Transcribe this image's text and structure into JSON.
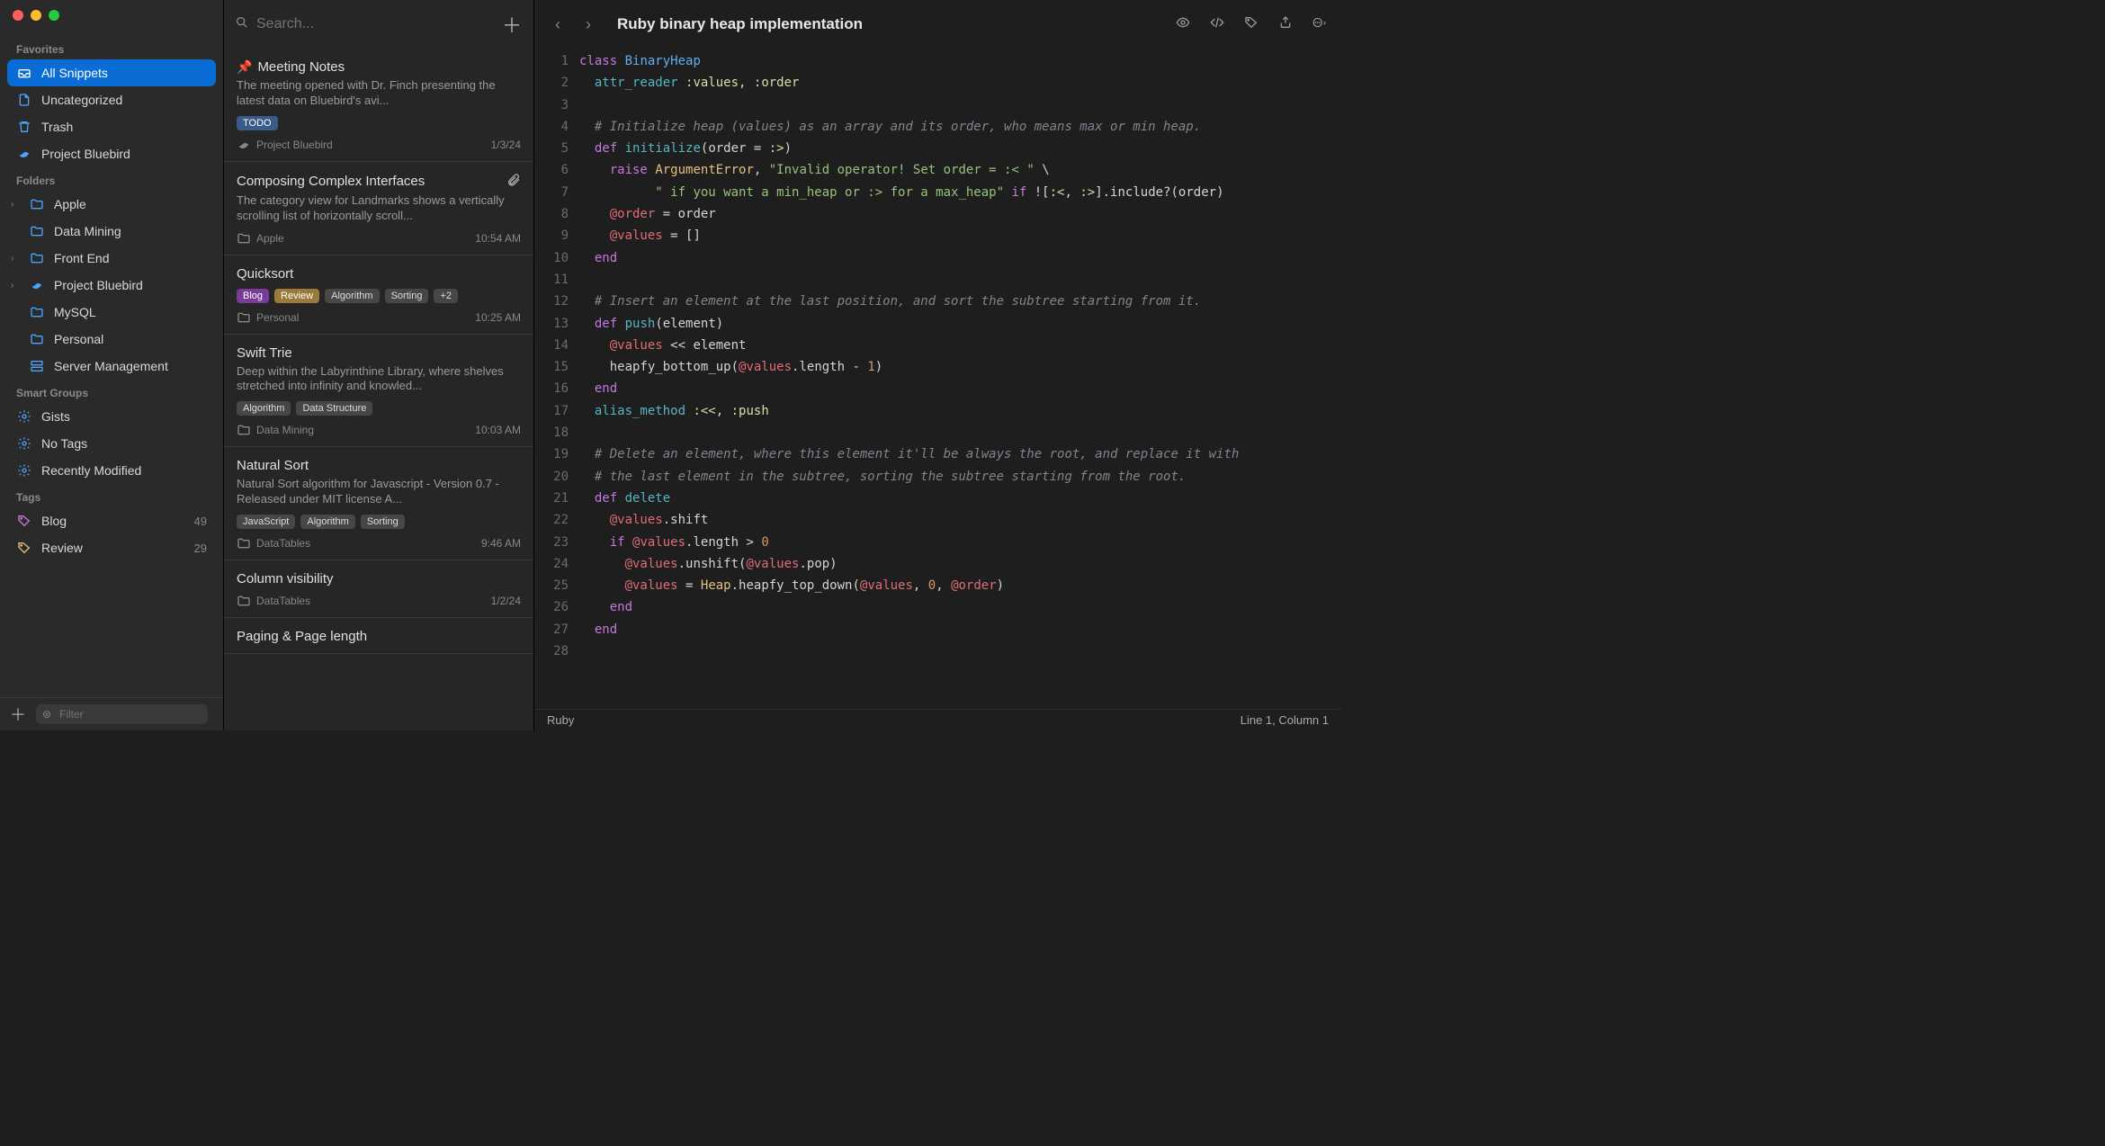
{
  "search": {
    "placeholder": "Search..."
  },
  "filter": {
    "placeholder": "Filter"
  },
  "sidebar": {
    "favorites_label": "Favorites",
    "folders_label": "Folders",
    "smart_label": "Smart Groups",
    "tags_label": "Tags",
    "favorites": [
      {
        "label": "All Snippets"
      },
      {
        "label": "Uncategorized"
      },
      {
        "label": "Trash"
      },
      {
        "label": "Project Bluebird"
      }
    ],
    "folders": [
      {
        "label": "Apple",
        "expandable": true
      },
      {
        "label": "Data Mining"
      },
      {
        "label": "Front End",
        "expandable": true
      },
      {
        "label": "Project Bluebird",
        "expandable": true
      },
      {
        "label": "MySQL"
      },
      {
        "label": "Personal"
      },
      {
        "label": "Server Management"
      }
    ],
    "smart": [
      {
        "label": "Gists"
      },
      {
        "label": "No Tags"
      },
      {
        "label": "Recently Modified"
      }
    ],
    "tags": [
      {
        "label": "Blog",
        "count": "49"
      },
      {
        "label": "Review",
        "count": "29"
      }
    ]
  },
  "snippets": [
    {
      "title": "Meeting Notes",
      "pinned": true,
      "preview": "The meeting opened with Dr. Finch presenting the latest data on Bluebird's avi...",
      "tags": [
        {
          "label": "TODO",
          "cls": "todo"
        }
      ],
      "folder": "Project Bluebird",
      "folder_icon": "bluebird",
      "time": "1/3/24"
    },
    {
      "title": "Composing Complex Interfaces",
      "attachment": true,
      "preview": "The category view for Landmarks shows a vertically scrolling list of horizontally scroll...",
      "tags": [],
      "folder": "Apple",
      "time": "10:54 AM"
    },
    {
      "title": "Quicksort",
      "preview": "",
      "tags": [
        {
          "label": "Blog",
          "cls": "blog"
        },
        {
          "label": "Review",
          "cls": "review"
        },
        {
          "label": "Algorithm",
          "cls": ""
        },
        {
          "label": "Sorting",
          "cls": ""
        },
        {
          "label": "+2",
          "cls": ""
        }
      ],
      "folder": "Personal",
      "time": "10:25 AM"
    },
    {
      "title": "Swift Trie",
      "preview": "Deep within the Labyrinthine Library, where shelves stretched into infinity and knowled...",
      "tags": [
        {
          "label": "Algorithm",
          "cls": ""
        },
        {
          "label": "Data Structure",
          "cls": ""
        }
      ],
      "folder": "Data Mining",
      "time": "10:03 AM"
    },
    {
      "title": "Natural Sort",
      "preview": "Natural Sort algorithm for Javascript - Version 0.7 - Released under MIT license A...",
      "tags": [
        {
          "label": "JavaScript",
          "cls": ""
        },
        {
          "label": "Algorithm",
          "cls": ""
        },
        {
          "label": "Sorting",
          "cls": ""
        }
      ],
      "folder": "DataTables",
      "time": "9:46 AM"
    },
    {
      "title": "Column visibility",
      "preview": "",
      "tags": [],
      "folder": "DataTables",
      "time": "1/2/24"
    },
    {
      "title": "Paging & Page length",
      "preview": "",
      "tags": [],
      "folder": "",
      "time": ""
    }
  ],
  "editor": {
    "title": "Ruby binary heap implementation",
    "language": "Ruby",
    "cursor": "Line 1, Column 1",
    "code": [
      {
        "n": 1,
        "html": "<span class='kw'>class</span> <span class='cls'>BinaryHeap</span>"
      },
      {
        "n": 2,
        "html": "  <span class='fn'>attr_reader</span> <span class='sym'>:values</span>, <span class='sym'>:order</span>"
      },
      {
        "n": 3,
        "html": ""
      },
      {
        "n": 4,
        "html": "  <span class='com'># Initialize heap (values) as an array and its order, who means max or min heap.</span>"
      },
      {
        "n": 5,
        "html": "  <span class='kw'>def</span> <span class='fn'>initialize</span>(order = <span class='sym'>:&gt;</span>)"
      },
      {
        "n": 6,
        "html": "    <span class='kw'>raise</span> <span class='const'>ArgumentError</span>, <span class='str'>\"Invalid operator! Set order = :&lt; \"</span> \\"
      },
      {
        "n": 7,
        "html": "          <span class='str'>\" if you want a min_heap or :&gt; for a max_heap\"</span> <span class='kw'>if</span> ![<span class='sym'>:&lt;</span>, <span class='sym'>:&gt;</span>].include?(order)"
      },
      {
        "n": 8,
        "html": "    <span class='ivar'>@order</span> = order"
      },
      {
        "n": 9,
        "html": "    <span class='ivar'>@values</span> = []"
      },
      {
        "n": 10,
        "html": "  <span class='kw'>end</span>"
      },
      {
        "n": 11,
        "html": ""
      },
      {
        "n": 12,
        "html": "  <span class='com'># Insert an element at the last position, and sort the subtree starting from it.</span>"
      },
      {
        "n": 13,
        "html": "  <span class='kw'>def</span> <span class='fn'>push</span>(element)"
      },
      {
        "n": 14,
        "html": "    <span class='ivar'>@values</span> &lt;&lt; element"
      },
      {
        "n": 15,
        "html": "    heapfy_bottom_up(<span class='ivar'>@values</span>.length - <span class='num'>1</span>)"
      },
      {
        "n": 16,
        "html": "  <span class='kw'>end</span>"
      },
      {
        "n": 17,
        "html": "  <span class='fn'>alias_method</span> <span class='sym'>:&lt;&lt;</span>, <span class='sym'>:push</span>"
      },
      {
        "n": 18,
        "html": ""
      },
      {
        "n": 19,
        "html": "  <span class='com'># Delete an element, where this element it'll be always the root, and replace it with</span>"
      },
      {
        "n": 20,
        "html": "  <span class='com'># the last element in the subtree, sorting the subtree starting from the root.</span>"
      },
      {
        "n": 21,
        "html": "  <span class='kw'>def</span> <span class='fn'>delete</span>"
      },
      {
        "n": 22,
        "html": "    <span class='ivar'>@values</span>.shift"
      },
      {
        "n": 23,
        "html": "    <span class='kw'>if</span> <span class='ivar'>@values</span>.length &gt; <span class='num'>0</span>"
      },
      {
        "n": 24,
        "html": "      <span class='ivar'>@values</span>.unshift(<span class='ivar'>@values</span>.pop)"
      },
      {
        "n": 25,
        "html": "      <span class='ivar'>@values</span> = <span class='const'>Heap</span>.heapfy_top_down(<span class='ivar'>@values</span>, <span class='num'>0</span>, <span class='ivar'>@order</span>)"
      },
      {
        "n": 26,
        "html": "    <span class='kw'>end</span>"
      },
      {
        "n": 27,
        "html": "  <span class='kw'>end</span>"
      },
      {
        "n": 28,
        "html": ""
      }
    ]
  }
}
